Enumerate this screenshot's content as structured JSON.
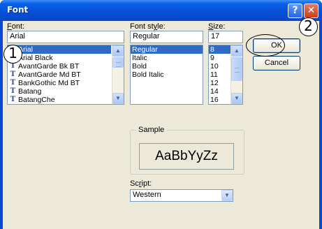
{
  "window": {
    "title": "Font",
    "help_glyph": "?",
    "close_glyph": "✕"
  },
  "font": {
    "label_prefix": "F",
    "label_rest": "ont:",
    "value": "Arial",
    "items": [
      {
        "name": "Arial",
        "icon": "opentype-icon",
        "glyph": "O",
        "selected": true
      },
      {
        "name": "Arial Black",
        "icon": "opentype-icon",
        "glyph": "O",
        "selected": false
      },
      {
        "name": "AvantGarde Bk BT",
        "icon": "truetype-icon",
        "glyph": "T",
        "selected": false
      },
      {
        "name": "AvantGarde Md BT",
        "icon": "truetype-icon",
        "glyph": "T",
        "selected": false
      },
      {
        "name": "BankGothic Md BT",
        "icon": "truetype-icon",
        "glyph": "T",
        "selected": false
      },
      {
        "name": "Batang",
        "icon": "truetype-icon",
        "glyph": "T",
        "selected": false
      },
      {
        "name": "BatangChe",
        "icon": "truetype-icon",
        "glyph": "T",
        "selected": false
      }
    ]
  },
  "style": {
    "label_prefix": "Font st",
    "label_u": "y",
    "label_rest": "le:",
    "value": "Regular",
    "items": [
      {
        "name": "Regular",
        "selected": true
      },
      {
        "name": "Italic",
        "selected": false
      },
      {
        "name": "Bold",
        "selected": false
      },
      {
        "name": "Bold Italic",
        "selected": false
      }
    ]
  },
  "size": {
    "label_prefix": "S",
    "label_rest": "ize:",
    "value": "17",
    "items": [
      {
        "name": "8",
        "selected": true
      },
      {
        "name": "9",
        "selected": false
      },
      {
        "name": "10",
        "selected": false
      },
      {
        "name": "11",
        "selected": false
      },
      {
        "name": "12",
        "selected": false
      },
      {
        "name": "14",
        "selected": false
      },
      {
        "name": "16",
        "selected": false
      }
    ]
  },
  "buttons": {
    "ok": "OK",
    "cancel": "Cancel"
  },
  "sample": {
    "title": "Sample",
    "text": "AaBbYyZz"
  },
  "script": {
    "label_prefix": "Sc",
    "label_u": "r",
    "label_rest": "ipt:",
    "value": "Western"
  },
  "callouts": {
    "one": "1",
    "two": "2"
  },
  "icons": {
    "scroll_up": "▲",
    "scroll_down": "▼",
    "dropdown": "▼"
  }
}
